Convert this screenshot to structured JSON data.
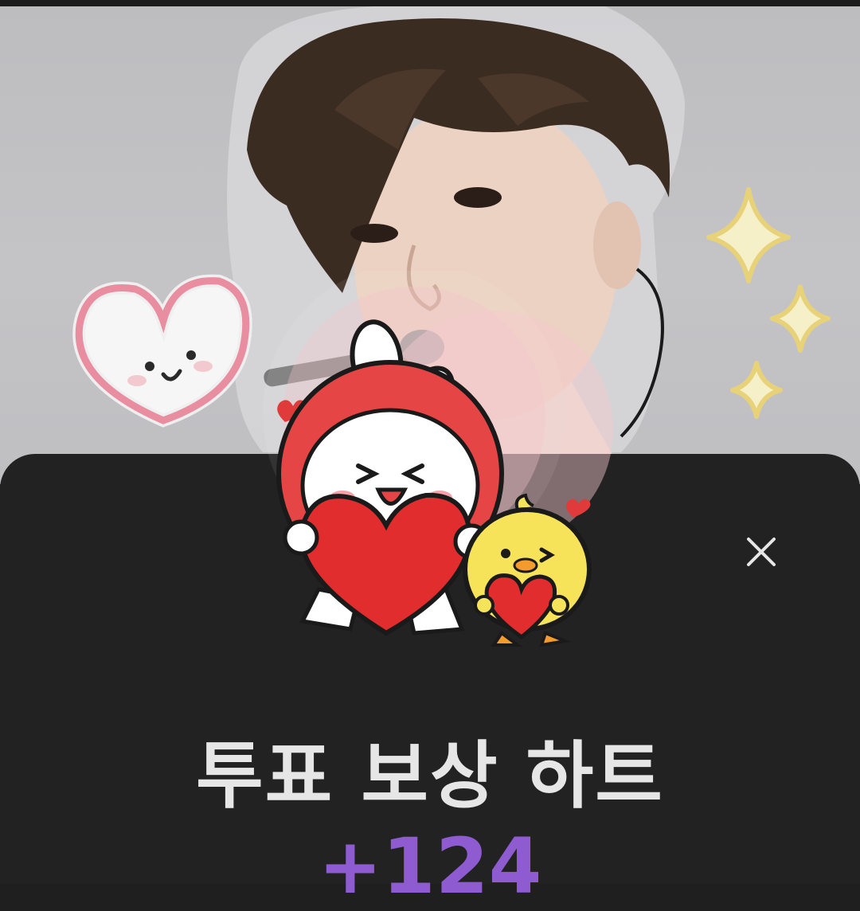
{
  "screen": {
    "background_color": "#1f1f1f",
    "sheet_color": "#222222"
  },
  "header_photo": {
    "stickers": [
      "heart-face-sticker",
      "sparkle-sticker"
    ],
    "accent_color": "#e98da0"
  },
  "reward_sheet": {
    "mascot": "bunny-and-chick-holding-hearts",
    "title": "투표 보상 하트",
    "amount": "+124",
    "amount_color": "#8e5bd0",
    "close_icon": "close-icon"
  }
}
